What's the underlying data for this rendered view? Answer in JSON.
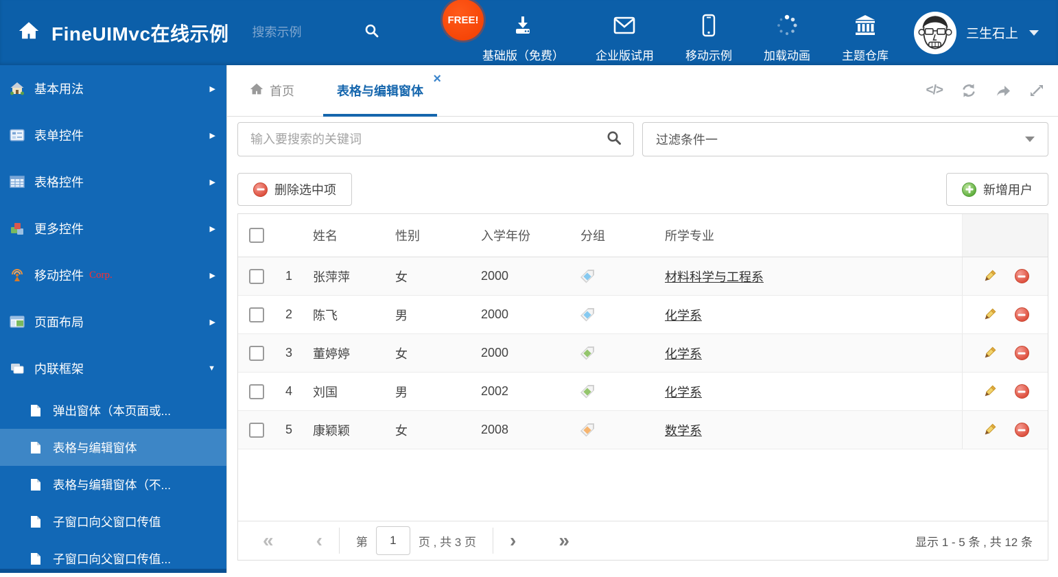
{
  "colors": {
    "header_bg": "#0c5fa9",
    "sidebar_bg": "#1268b6",
    "sidebar_selected": "#3d86c6",
    "accent_blue": "#1566ad",
    "badge_orange": "#f23d00",
    "tag_blue": "#86c9f0",
    "tag_green": "#94c56d",
    "tag_orange": "#f6b46e"
  },
  "icons": {
    "close": "×",
    "arrow_right": "▶",
    "arrow_down": "▼",
    "code": "</>",
    "pager_first": "«",
    "pager_prev": "‹",
    "pager_next": "›",
    "pager_last": "»"
  },
  "header": {
    "title": "FineUIMvc在线示例",
    "search_placeholder": "搜索示例",
    "nav": [
      {
        "label": "基础版（免费）",
        "icon": "download-icon",
        "badge": "FREE!"
      },
      {
        "label": "企业版试用",
        "icon": "envelope-icon"
      },
      {
        "label": "移动示例",
        "icon": "mobile-icon"
      },
      {
        "label": "加载动画",
        "icon": "spinner-icon"
      },
      {
        "label": "主题仓库",
        "icon": "bank-icon"
      }
    ],
    "user": {
      "name": "三生石上"
    }
  },
  "sidebar": {
    "items": [
      {
        "label": "基本用法"
      },
      {
        "label": "表单控件"
      },
      {
        "label": "表格控件"
      },
      {
        "label": "更多控件"
      },
      {
        "label": "移动控件",
        "badge": "Corp."
      },
      {
        "label": "页面布局"
      },
      {
        "label": "内联框架",
        "expanded": true
      }
    ],
    "subitems": [
      {
        "label": "弹出窗体（本页面或..."
      },
      {
        "label": "表格与编辑窗体",
        "selected": true
      },
      {
        "label": "表格与编辑窗体（不..."
      },
      {
        "label": "子窗口向父窗口传值"
      },
      {
        "label": "子窗口向父窗口传值..."
      }
    ]
  },
  "tabs": {
    "home": {
      "label": "首页"
    },
    "active": {
      "label": "表格与编辑窗体"
    }
  },
  "search": {
    "placeholder": "输入要搜索的关键词"
  },
  "filter": {
    "value": "过滤条件一"
  },
  "toolbar": {
    "delete_label": "删除选中项",
    "add_label": "新增用户"
  },
  "grid": {
    "columns": {
      "name": "姓名",
      "gender": "性别",
      "year": "入学年份",
      "group": "分组",
      "major": "所学专业"
    },
    "rows": [
      {
        "num": "1",
        "name": "张萍萍",
        "gender": "女",
        "year": "2000",
        "tag_color": "#86c9f0",
        "major": "材料科学与工程系"
      },
      {
        "num": "2",
        "name": "陈飞",
        "gender": "男",
        "year": "2000",
        "tag_color": "#86c9f0",
        "major": "化学系"
      },
      {
        "num": "3",
        "name": "董婷婷",
        "gender": "女",
        "year": "2000",
        "tag_color": "#94c56d",
        "major": "化学系"
      },
      {
        "num": "4",
        "name": "刘国",
        "gender": "男",
        "year": "2002",
        "tag_color": "#94c56d",
        "major": "化学系"
      },
      {
        "num": "5",
        "name": "康颖颖",
        "gender": "女",
        "year": "2008",
        "tag_color": "#f6b46e",
        "major": "数学系"
      }
    ],
    "pager": {
      "page_prefix": "第",
      "page": "1",
      "page_suffix": "页 , 共 3 页",
      "summary": "显示 1 - 5 条 , 共 12 条"
    }
  }
}
